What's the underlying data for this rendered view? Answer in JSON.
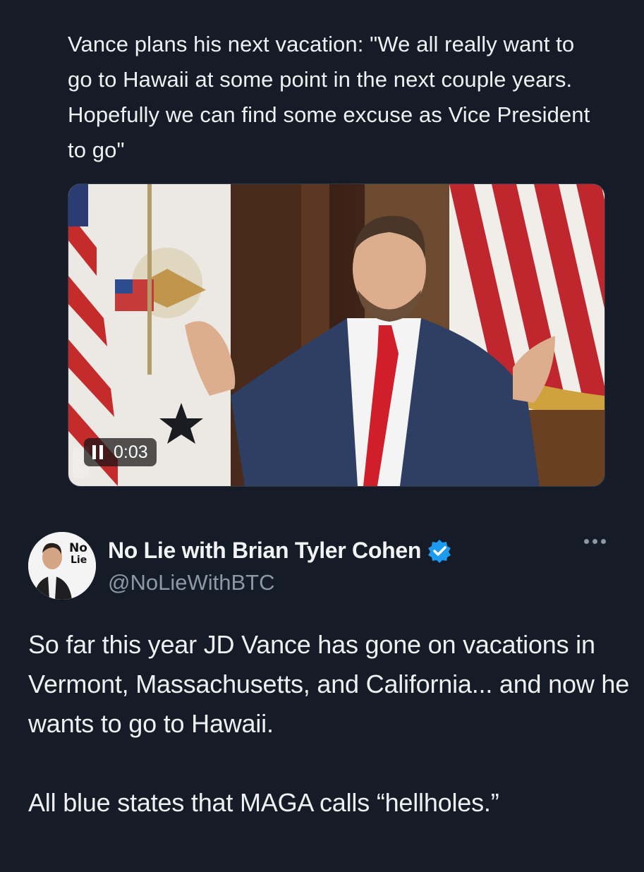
{
  "quoted_tweet": {
    "text": "Vance plans his next vacation: \"We all really want to go to Hawaii at some point in the next couple years. Hopefully we can find some excuse as Vice President to go\"",
    "video": {
      "timestamp": "0:03",
      "playback_state": "playing",
      "control_icon": "pause-icon"
    }
  },
  "tweet": {
    "author": {
      "display_name": "No Lie with Brian Tyler Cohen",
      "handle": "@NoLieWithBTC",
      "avatar_text": "No Lie",
      "verified": true,
      "verified_color": "#1d9bf0"
    },
    "body": [
      "So far this year JD Vance has gone on vacations in Vermont, Massachusetts, and California... and now he wants to go to Hawaii.",
      "All blue states that MAGA calls “hellholes.”"
    ],
    "menu_icon": "more-icon"
  },
  "colors": {
    "background": "#151c27",
    "text_primary": "#eef0f1",
    "text_secondary": "#8b98a5"
  }
}
